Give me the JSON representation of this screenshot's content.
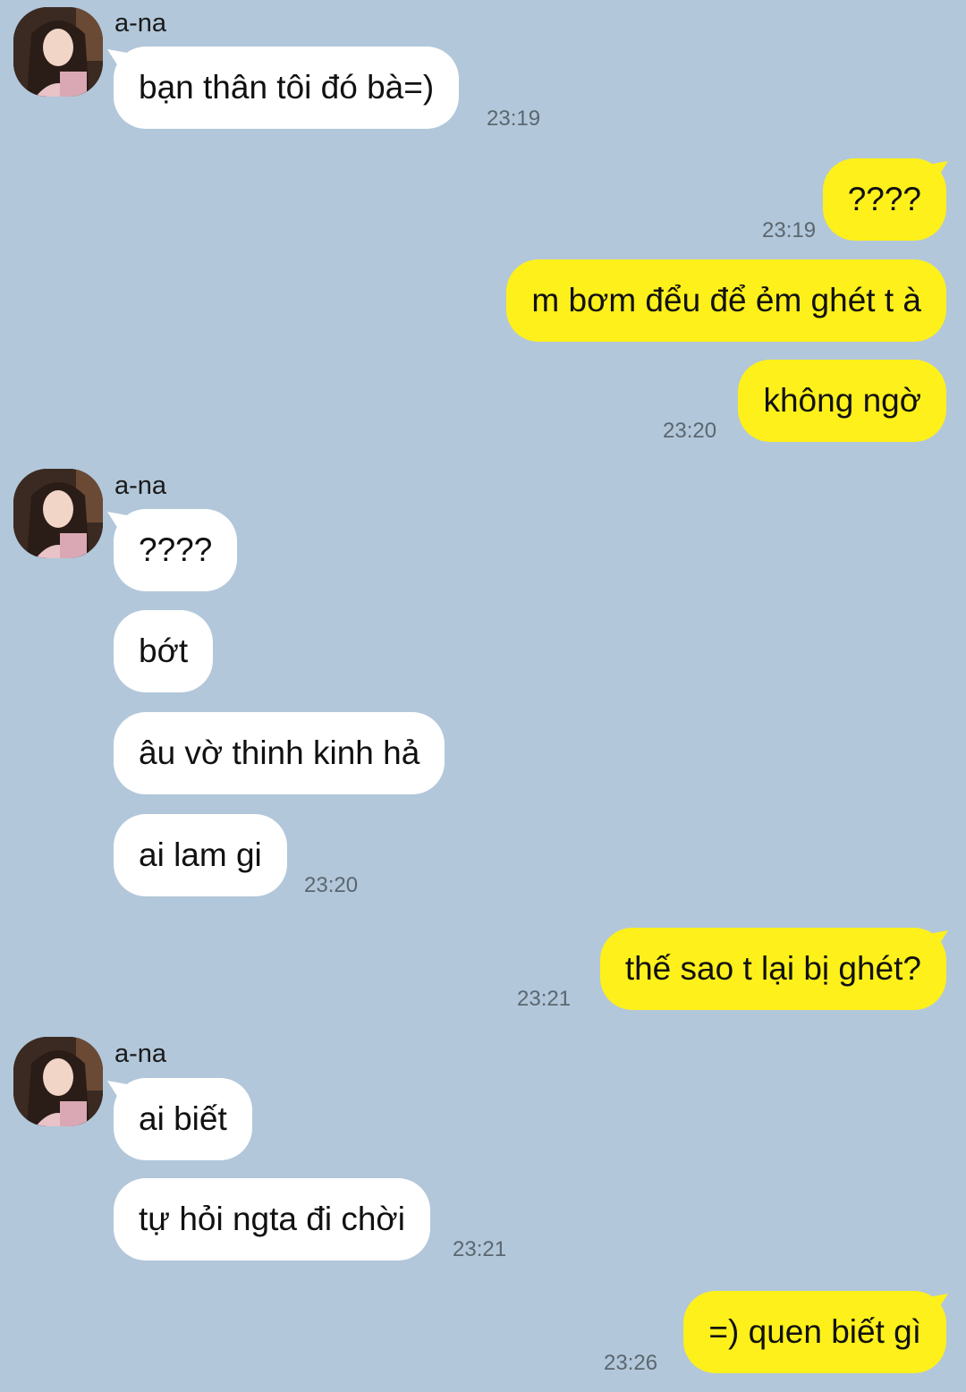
{
  "contact": {
    "name": "a-na"
  },
  "messages": [
    {
      "side": "in",
      "text": "bạn thân tôi đó bà=)",
      "time": "23:19"
    },
    {
      "side": "out",
      "text": "????",
      "time": "23:19"
    },
    {
      "side": "out",
      "text": "m bơm đểu để ẻm ghét t à"
    },
    {
      "side": "out",
      "text": "không ngờ",
      "time": "23:20"
    },
    {
      "side": "in",
      "text": "????"
    },
    {
      "side": "in",
      "text": "bớt"
    },
    {
      "side": "in",
      "text": "âu vờ thinh kinh hả"
    },
    {
      "side": "in",
      "text": "ai lam gi",
      "time": "23:20"
    },
    {
      "side": "out",
      "text": "thế sao t lại bị ghét?",
      "time": "23:21"
    },
    {
      "side": "in",
      "text": "ai biết"
    },
    {
      "side": "in",
      "text": "tự hỏi ngta đi chời",
      "time": "23:21"
    },
    {
      "side": "out",
      "text": "=) quen biết gì",
      "time": "23:26"
    }
  ],
  "colors": {
    "background": "#b2c7da",
    "incoming": "#ffffff",
    "outgoing": "#fef01b"
  },
  "icons": {
    "avatar": "profile-photo"
  }
}
